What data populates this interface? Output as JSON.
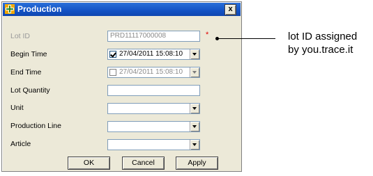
{
  "window": {
    "title": "Production",
    "close_label": "x"
  },
  "form": {
    "lot_id": {
      "label": "Lot ID",
      "value": "PRD11117000008",
      "required_mark": "*"
    },
    "begin_time": {
      "label": "Begin Time",
      "value": "27/04/2011 15:08:10",
      "checked": true
    },
    "end_time": {
      "label": "End Time",
      "value": "27/04/2011 15:08:10",
      "checked": false
    },
    "lot_quantity": {
      "label": "Lot Quantity",
      "value": ""
    },
    "unit": {
      "label": "Unit",
      "value": ""
    },
    "production_line": {
      "label": "Production Line",
      "value": ""
    },
    "article": {
      "label": "Article",
      "value": ""
    }
  },
  "buttons": {
    "ok": "OK",
    "cancel": "Cancel",
    "apply": "Apply"
  },
  "annotation": {
    "line1": "lot ID assigned",
    "line2": "by you.trace.it"
  }
}
